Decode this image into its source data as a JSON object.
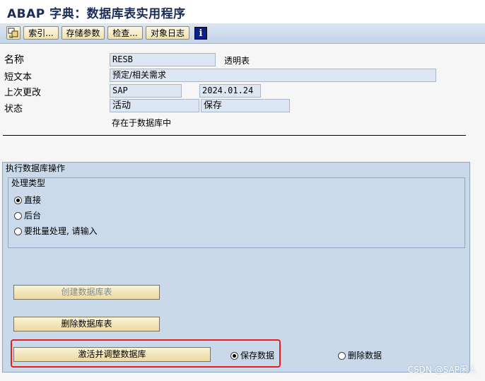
{
  "window": {
    "title": "ABAP 字典：数据库表实用程序"
  },
  "toolbar": {
    "buttons": [
      "索引...",
      "存储参数",
      "检查...",
      "对象日志"
    ],
    "info": "i"
  },
  "header": {
    "name_label": "名称",
    "name_value": "RESB",
    "name_type": "透明表",
    "short_label": "短文本",
    "short_value": "预定/相关需求",
    "changed_label": "上次更改",
    "changed_by": "SAP",
    "changed_on": "2024.01.24",
    "status_label": "状态",
    "status_active": "活动",
    "status_saved": "保存",
    "exists": "存在于数据库中"
  },
  "ops": {
    "title": "执行数据库操作",
    "proc_title": "处理类型",
    "options": [
      "直接",
      "后台",
      "要批量处理, 请输入"
    ],
    "selected": "直接",
    "create_btn": "创建数据库表",
    "delete_btn": "删除数据库表",
    "activate_btn": "激活并调整数据库",
    "keep_data": "保存数据",
    "delete_data": "删除数据"
  },
  "watermark": "CSDN @SAP闲人"
}
